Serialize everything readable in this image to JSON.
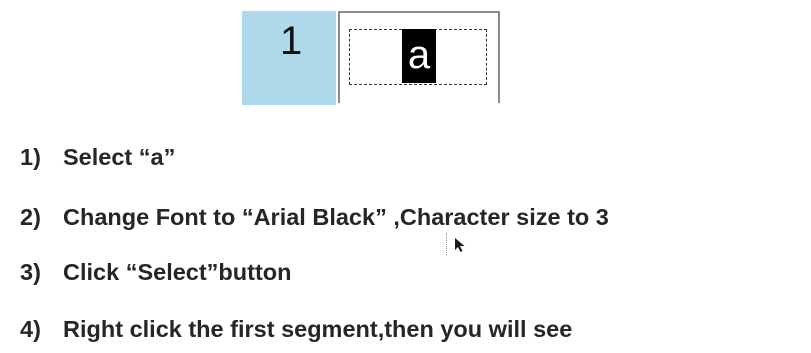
{
  "steps": [
    {
      "number": "1)",
      "text": "Select “a”"
    },
    {
      "number": "2)",
      "text": "Change Font to “Arial Black” ,Character size to 3"
    },
    {
      "number": "3)",
      "text": "Click “Select”button"
    },
    {
      "number": "4)",
      "text": "Right click the first segment,then you will see"
    }
  ],
  "segment_widget": {
    "segment_number": "1",
    "selected_char": "a"
  },
  "select_button": {
    "icon": "cursor-arrow-icon"
  },
  "colors": {
    "text": "#262626",
    "segment_number_bg": "#afd8ea",
    "highlight_bg": "#000000"
  }
}
